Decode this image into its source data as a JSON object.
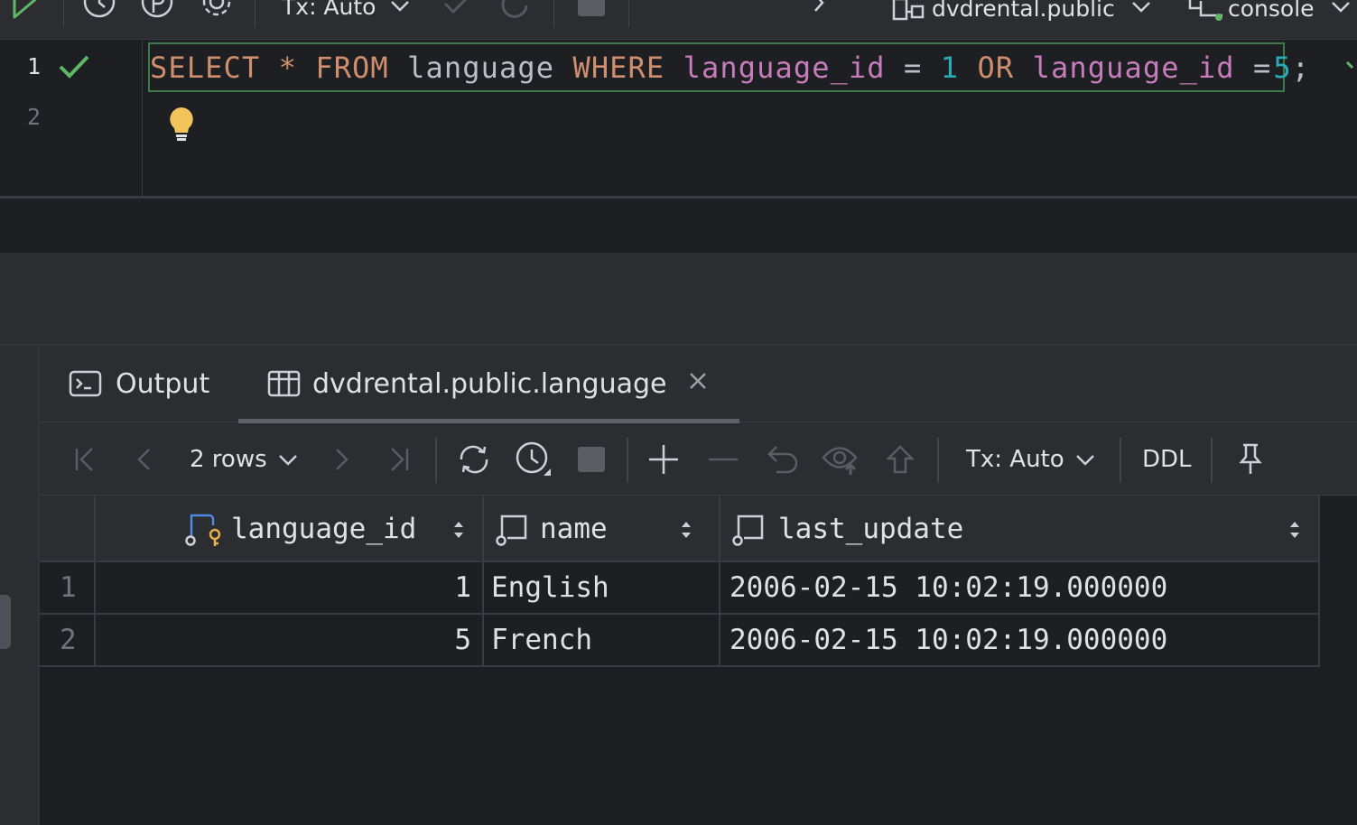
{
  "toolbar": {
    "tx_label": "Tx: Auto",
    "schema_label": "dvdrental.public",
    "session_label": "console"
  },
  "editor": {
    "line_numbers": [
      "1",
      "2"
    ],
    "tokens": {
      "t1": "SELECT",
      "t2": " ",
      "t3": "*",
      "t4": " ",
      "t5": "FROM",
      "t6": " language ",
      "t7": "WHERE",
      "t8": " ",
      "t9": "language_id",
      "t10": " = ",
      "t11": "1",
      "t12": " ",
      "t13": "OR",
      "t14": " ",
      "t15": "language_id",
      "t16": " =",
      "t17": " ",
      "t18": "5",
      "t19": ";"
    }
  },
  "services": {
    "tabs": {
      "output_label": "Output",
      "result_label": "dvdrental.public.language"
    },
    "result_toolbar": {
      "rows_label": "2 rows",
      "tx_label": "Tx: Auto",
      "ddl_label": "DDL"
    }
  },
  "grid": {
    "columns": [
      "language_id",
      "name",
      "last_update"
    ],
    "rows": [
      {
        "num": "1",
        "language_id": "1",
        "name": "English",
        "last_update": "2006-02-15 10:02:19.000000"
      },
      {
        "num": "2",
        "language_id": "5",
        "name": "French",
        "last_update": "2006-02-15 10:02:19.000000"
      }
    ]
  },
  "colors": {
    "keyword": "#cf8e6d",
    "column": "#c77dbb",
    "number": "#2aacb8",
    "success": "#5fb865",
    "intention_bulb": "#f2c55c",
    "background": "#1e1f22",
    "panel": "#2b2d30"
  },
  "icons": [
    "run-icon",
    "history-icon",
    "explain-plan-icon",
    "settings-icon",
    "chevron-down-icon",
    "commit-icon",
    "rollback-icon",
    "stop-icon",
    "chevron-right-icon",
    "schema-icon",
    "console-icon",
    "checkmark-icon",
    "lightbulb-icon",
    "terminal-icon",
    "table-icon",
    "close-icon",
    "first-page-icon",
    "previous-page-icon",
    "next-page-icon",
    "last-page-icon",
    "refresh-icon",
    "query-history-icon",
    "add-row-icon",
    "delete-row-icon",
    "revert-icon",
    "preview-changes-icon",
    "submit-icon",
    "pin-icon",
    "primary-key-column-icon",
    "column-icon",
    "sort-icon"
  ]
}
